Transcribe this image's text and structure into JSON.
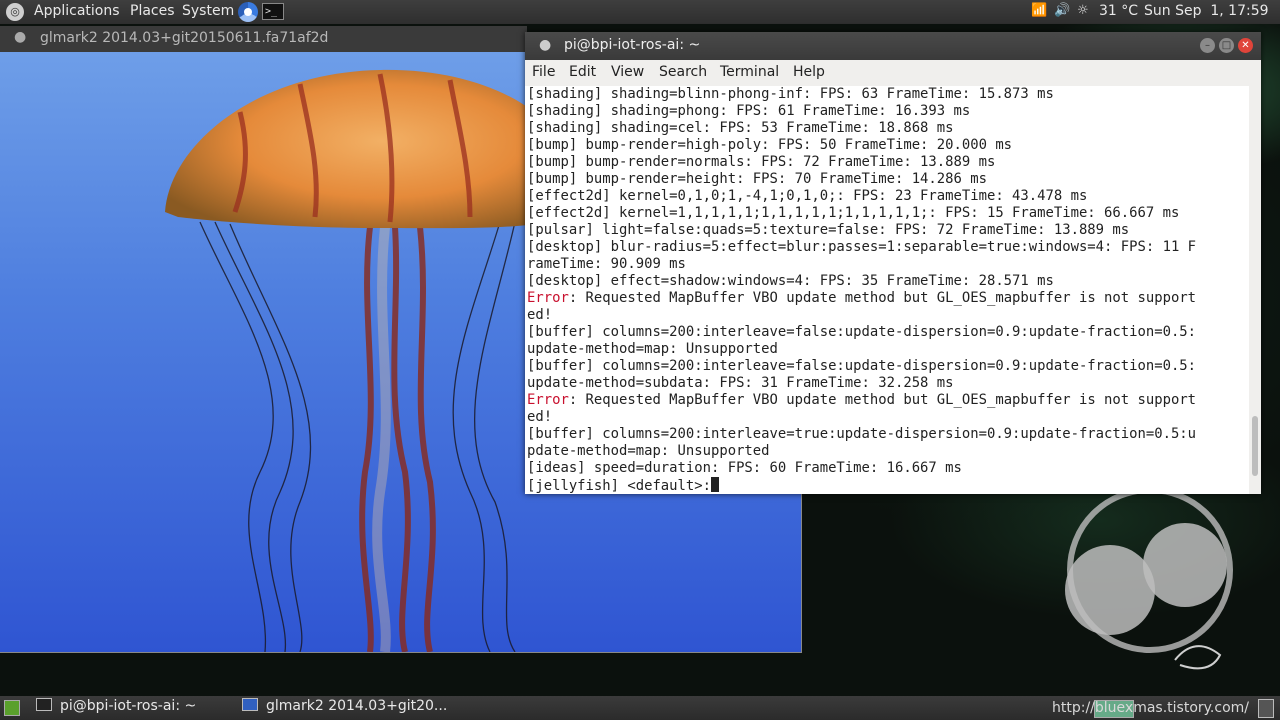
{
  "top_panel": {
    "menus": [
      "Applications",
      "Places",
      "System"
    ],
    "temperature": "31 °C",
    "clock": "Sun Sep  1, 17:59"
  },
  "glmark_window": {
    "title": "glmark2 2014.03+git20150611.fa71af2d"
  },
  "terminal": {
    "title": "pi@bpi-iot-ros-ai: ~",
    "menu": [
      "File",
      "Edit",
      "View",
      "Search",
      "Terminal",
      "Help"
    ],
    "lines": [
      {
        "prefix": "",
        "text": "[shading] shading=blinn-phong-inf: FPS: 63 FrameTime: 15.873 ms"
      },
      {
        "prefix": "",
        "text": "[shading] shading=phong: FPS: 61 FrameTime: 16.393 ms"
      },
      {
        "prefix": "",
        "text": "[shading] shading=cel: FPS: 53 FrameTime: 18.868 ms"
      },
      {
        "prefix": "",
        "text": "[bump] bump-render=high-poly: FPS: 50 FrameTime: 20.000 ms"
      },
      {
        "prefix": "",
        "text": "[bump] bump-render=normals: FPS: 72 FrameTime: 13.889 ms"
      },
      {
        "prefix": "",
        "text": "[bump] bump-render=height: FPS: 70 FrameTime: 14.286 ms"
      },
      {
        "prefix": "",
        "text": "[effect2d] kernel=0,1,0;1,-4,1;0,1,0;: FPS: 23 FrameTime: 43.478 ms"
      },
      {
        "prefix": "",
        "text": "[effect2d] kernel=1,1,1,1,1;1,1,1,1,1;1,1,1,1,1;: FPS: 15 FrameTime: 66.667 ms"
      },
      {
        "prefix": "",
        "text": "[pulsar] light=false:quads=5:texture=false: FPS: 72 FrameTime: 13.889 ms"
      },
      {
        "prefix": "",
        "text": "[desktop] blur-radius=5:effect=blur:passes=1:separable=true:windows=4: FPS: 11 F"
      },
      {
        "prefix": "",
        "text": "rameTime: 90.909 ms"
      },
      {
        "prefix": "",
        "text": "[desktop] effect=shadow:windows=4: FPS: 35 FrameTime: 28.571 ms"
      },
      {
        "prefix": "Error",
        "text": ": Requested MapBuffer VBO update method but GL_OES_mapbuffer is not support"
      },
      {
        "prefix": "",
        "text": "ed!"
      },
      {
        "prefix": "",
        "text": "[buffer] columns=200:interleave=false:update-dispersion=0.9:update-fraction=0.5:"
      },
      {
        "prefix": "",
        "text": "update-method=map: Unsupported"
      },
      {
        "prefix": "",
        "text": "[buffer] columns=200:interleave=false:update-dispersion=0.9:update-fraction=0.5:"
      },
      {
        "prefix": "",
        "text": "update-method=subdata: FPS: 31 FrameTime: 32.258 ms"
      },
      {
        "prefix": "Error",
        "text": ": Requested MapBuffer VBO update method but GL_OES_mapbuffer is not support"
      },
      {
        "prefix": "",
        "text": "ed!"
      },
      {
        "prefix": "",
        "text": "[buffer] columns=200:interleave=true:update-dispersion=0.9:update-fraction=0.5:u"
      },
      {
        "prefix": "",
        "text": "pdate-method=map: Unsupported"
      },
      {
        "prefix": "",
        "text": "[ideas] speed=duration: FPS: 60 FrameTime: 16.667 ms"
      },
      {
        "prefix": "",
        "text": "[jellyfish] <default>:"
      }
    ]
  },
  "taskbar": {
    "items": [
      "pi@bpi-iot-ros-ai: ~",
      "glmark2 2014.03+git20..."
    ]
  },
  "watermark": "http://bluexmas.tistory.com/",
  "colors": {
    "panel": "#2e2e2e",
    "error": "#c8102e",
    "close_button": "#e0443a"
  }
}
